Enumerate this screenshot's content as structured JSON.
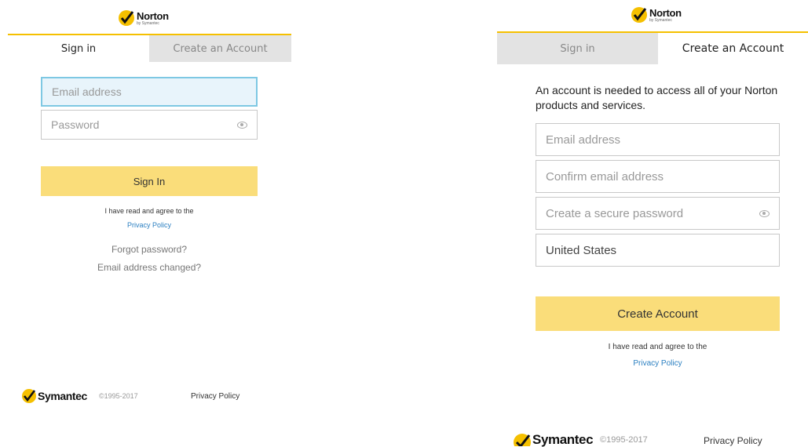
{
  "brand": {
    "name": "Norton",
    "sub": "by Symantec",
    "accent": "#f5c000",
    "button_color": "#fadd7a"
  },
  "left": {
    "tabs": {
      "signin": "Sign in",
      "create": "Create an Account"
    },
    "email_placeholder": "Email address",
    "password_placeholder": "Password",
    "signin_button": "Sign In",
    "agree_text": "I have read and agree to the",
    "privacy_link": "Privacy Policy",
    "forgot": "Forgot password?",
    "email_changed": "Email address changed?",
    "footer": {
      "brand": "Symantec",
      "copyright": "©1995-2017",
      "privacy": "Privacy Policy"
    }
  },
  "right": {
    "tabs": {
      "signin": "Sign in",
      "create": "Create an Account"
    },
    "description": "An account is needed to access all of your Norton products and services.",
    "email_placeholder": "Email address",
    "confirm_placeholder": "Confirm email address",
    "password_placeholder": "Create a secure password",
    "country_value": "United States",
    "create_button": "Create Account",
    "agree_text": "I have read and agree to the",
    "privacy_link": "Privacy Policy",
    "footer": {
      "brand": "Symantec",
      "copyright": "©1995-2017",
      "privacy": "Privacy Policy"
    }
  }
}
